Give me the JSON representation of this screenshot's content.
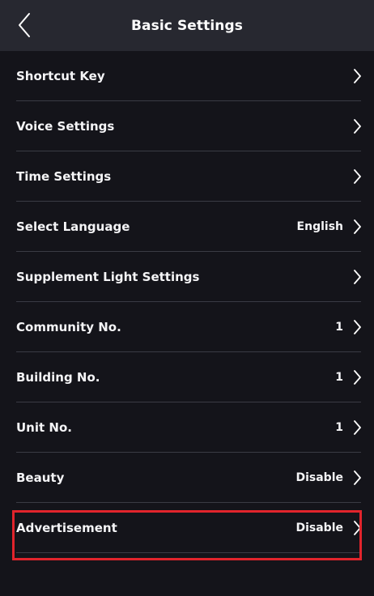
{
  "header": {
    "title": "Basic Settings",
    "back_icon": "chevron-left-icon"
  },
  "settings": {
    "items": [
      {
        "label": "Shortcut Key",
        "value": ""
      },
      {
        "label": "Voice Settings",
        "value": ""
      },
      {
        "label": "Time Settings",
        "value": ""
      },
      {
        "label": "Select Language",
        "value": "English"
      },
      {
        "label": "Supplement Light Settings",
        "value": ""
      },
      {
        "label": "Community No.",
        "value": "1"
      },
      {
        "label": "Building No.",
        "value": "1"
      },
      {
        "label": "Unit No.",
        "value": "1"
      },
      {
        "label": "Beauty",
        "value": "Disable"
      },
      {
        "label": "Advertisement",
        "value": "Disable"
      }
    ],
    "row_icon": "chevron-right-icon"
  },
  "colors": {
    "background": "#14141a",
    "header_background": "#272830",
    "divider": "#3a3b44",
    "text": "#f4f4f6",
    "highlight_border": "#e1242c"
  }
}
